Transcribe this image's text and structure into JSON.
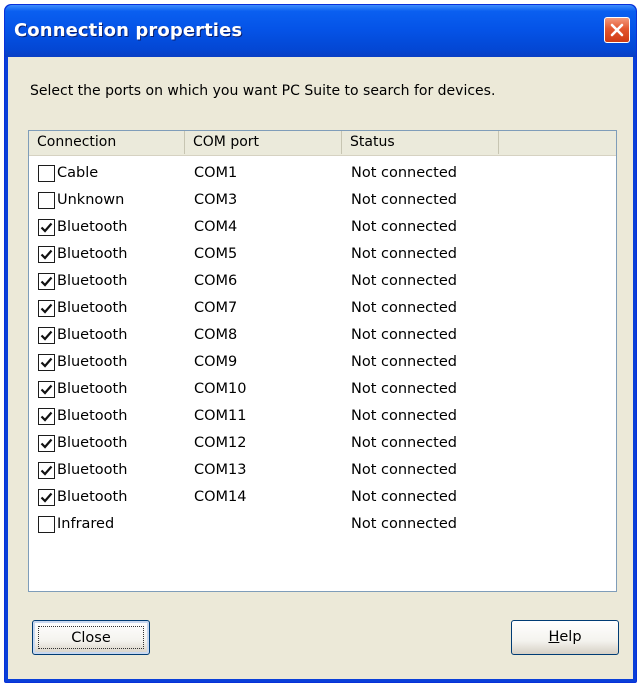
{
  "window": {
    "title": "Connection properties"
  },
  "instruction": "Select the ports on which you want PC Suite to search for devices.",
  "columns": {
    "connection": "Connection",
    "com_port": "COM port",
    "status": "Status"
  },
  "rows": [
    {
      "connection": "Cable",
      "port": "COM1",
      "status": "Not connected",
      "checked": false
    },
    {
      "connection": "Unknown",
      "port": "COM3",
      "status": "Not connected",
      "checked": false
    },
    {
      "connection": "Bluetooth",
      "port": "COM4",
      "status": "Not connected",
      "checked": true
    },
    {
      "connection": "Bluetooth",
      "port": "COM5",
      "status": "Not connected",
      "checked": true
    },
    {
      "connection": "Bluetooth",
      "port": "COM6",
      "status": "Not connected",
      "checked": true
    },
    {
      "connection": "Bluetooth",
      "port": "COM7",
      "status": "Not connected",
      "checked": true
    },
    {
      "connection": "Bluetooth",
      "port": "COM8",
      "status": "Not connected",
      "checked": true
    },
    {
      "connection": "Bluetooth",
      "port": "COM9",
      "status": "Not connected",
      "checked": true
    },
    {
      "connection": "Bluetooth",
      "port": "COM10",
      "status": "Not connected",
      "checked": true
    },
    {
      "connection": "Bluetooth",
      "port": "COM11",
      "status": "Not connected",
      "checked": true
    },
    {
      "connection": "Bluetooth",
      "port": "COM12",
      "status": "Not connected",
      "checked": true
    },
    {
      "connection": "Bluetooth",
      "port": "COM13",
      "status": "Not connected",
      "checked": true
    },
    {
      "connection": "Bluetooth",
      "port": "COM14",
      "status": "Not connected",
      "checked": true
    },
    {
      "connection": "Infrared",
      "port": "",
      "status": "Not connected",
      "checked": false
    }
  ],
  "buttons": {
    "close_label": "Close",
    "help_label_prefix": "",
    "help_label_mnemonic": "H",
    "help_label_rest": "elp"
  },
  "icons": {
    "titlebar_close": "close-icon",
    "checkbox_check": "checkmark-icon"
  },
  "colors": {
    "titlebar": "#0554e8",
    "titlebar_close": "#e3572f",
    "dialog_background": "#ece9d8",
    "list_border": "#7f9db9"
  }
}
